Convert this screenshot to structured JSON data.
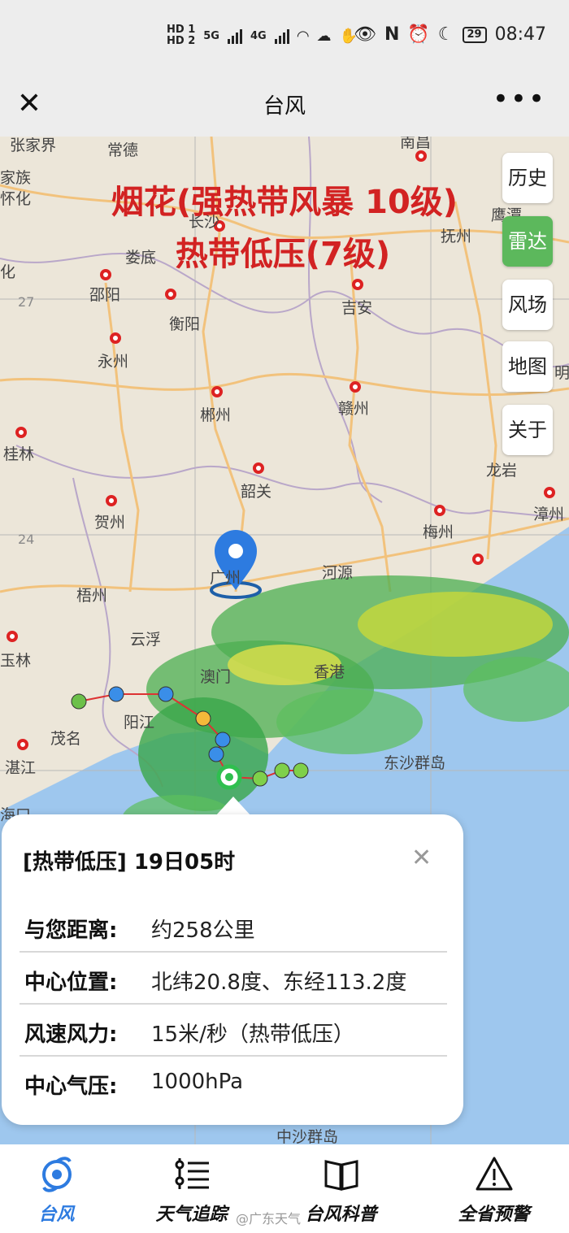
{
  "status_bar": {
    "sim1": "HD 1",
    "sim2": "HD 2",
    "net1": "5G",
    "net2": "4G",
    "battery": "29",
    "time": "08:47"
  },
  "title_bar": {
    "title": "台风",
    "close_icon": "close-icon",
    "more_icon": "more-icon"
  },
  "map": {
    "headline_line1": "烟花(强热带风暴 10级)",
    "headline_line2": "热带低压(7级)",
    "latitude_labels": [
      "27",
      "24"
    ],
    "cities": [
      {
        "name": "张家界"
      },
      {
        "name": "常德"
      },
      {
        "name": "南昌"
      },
      {
        "name": "家族"
      },
      {
        "name": "怀化"
      },
      {
        "name": "长沙"
      },
      {
        "name": "鹰潭"
      },
      {
        "name": "娄底"
      },
      {
        "name": "抚州"
      },
      {
        "name": "化"
      },
      {
        "name": "邵阳"
      },
      {
        "name": "吉安"
      },
      {
        "name": "衡阳"
      },
      {
        "name": "永州"
      },
      {
        "name": "郴州"
      },
      {
        "name": "赣州"
      },
      {
        "name": "桂林"
      },
      {
        "name": "韶关"
      },
      {
        "name": "龙岩"
      },
      {
        "name": "贺州"
      },
      {
        "name": "梅州"
      },
      {
        "name": "漳州"
      },
      {
        "name": "梧州"
      },
      {
        "name": "广州"
      },
      {
        "name": "河源"
      },
      {
        "name": "云浮"
      },
      {
        "name": "玉林"
      },
      {
        "name": "澳门"
      },
      {
        "name": "香港"
      },
      {
        "name": "阳江"
      },
      {
        "name": "茂名"
      },
      {
        "name": "湛江"
      },
      {
        "name": "海口"
      },
      {
        "name": "东沙群岛"
      },
      {
        "name": "中沙群岛"
      },
      {
        "name": "明"
      }
    ],
    "side_buttons": [
      "历史",
      "雷达",
      "风场",
      "地图",
      "关于"
    ],
    "active_side_button": "雷达",
    "accent_color": "#5cb85c",
    "headline_color": "#d22222"
  },
  "popup": {
    "header": "[热带低压] 19日05时",
    "close_icon": "close-icon",
    "rows": [
      {
        "label": "与您距离:",
        "value": "约258公里"
      },
      {
        "label": "中心位置:",
        "value": "北纬20.8度、东经113.2度"
      },
      {
        "label": "风速风力:",
        "value": "15米/秒（热带低压）"
      },
      {
        "label": "中心气压:",
        "value": "1000hPa"
      }
    ]
  },
  "bottom_nav": {
    "items": [
      {
        "label": "台风",
        "icon": "typhoon-icon"
      },
      {
        "label": "天气追踪",
        "icon": "list-icon"
      },
      {
        "label": "台风科普",
        "icon": "book-icon"
      },
      {
        "label": "全省预警",
        "icon": "warning-icon"
      }
    ],
    "active_color": "#2d7be0",
    "watermark": "@广东天气"
  }
}
